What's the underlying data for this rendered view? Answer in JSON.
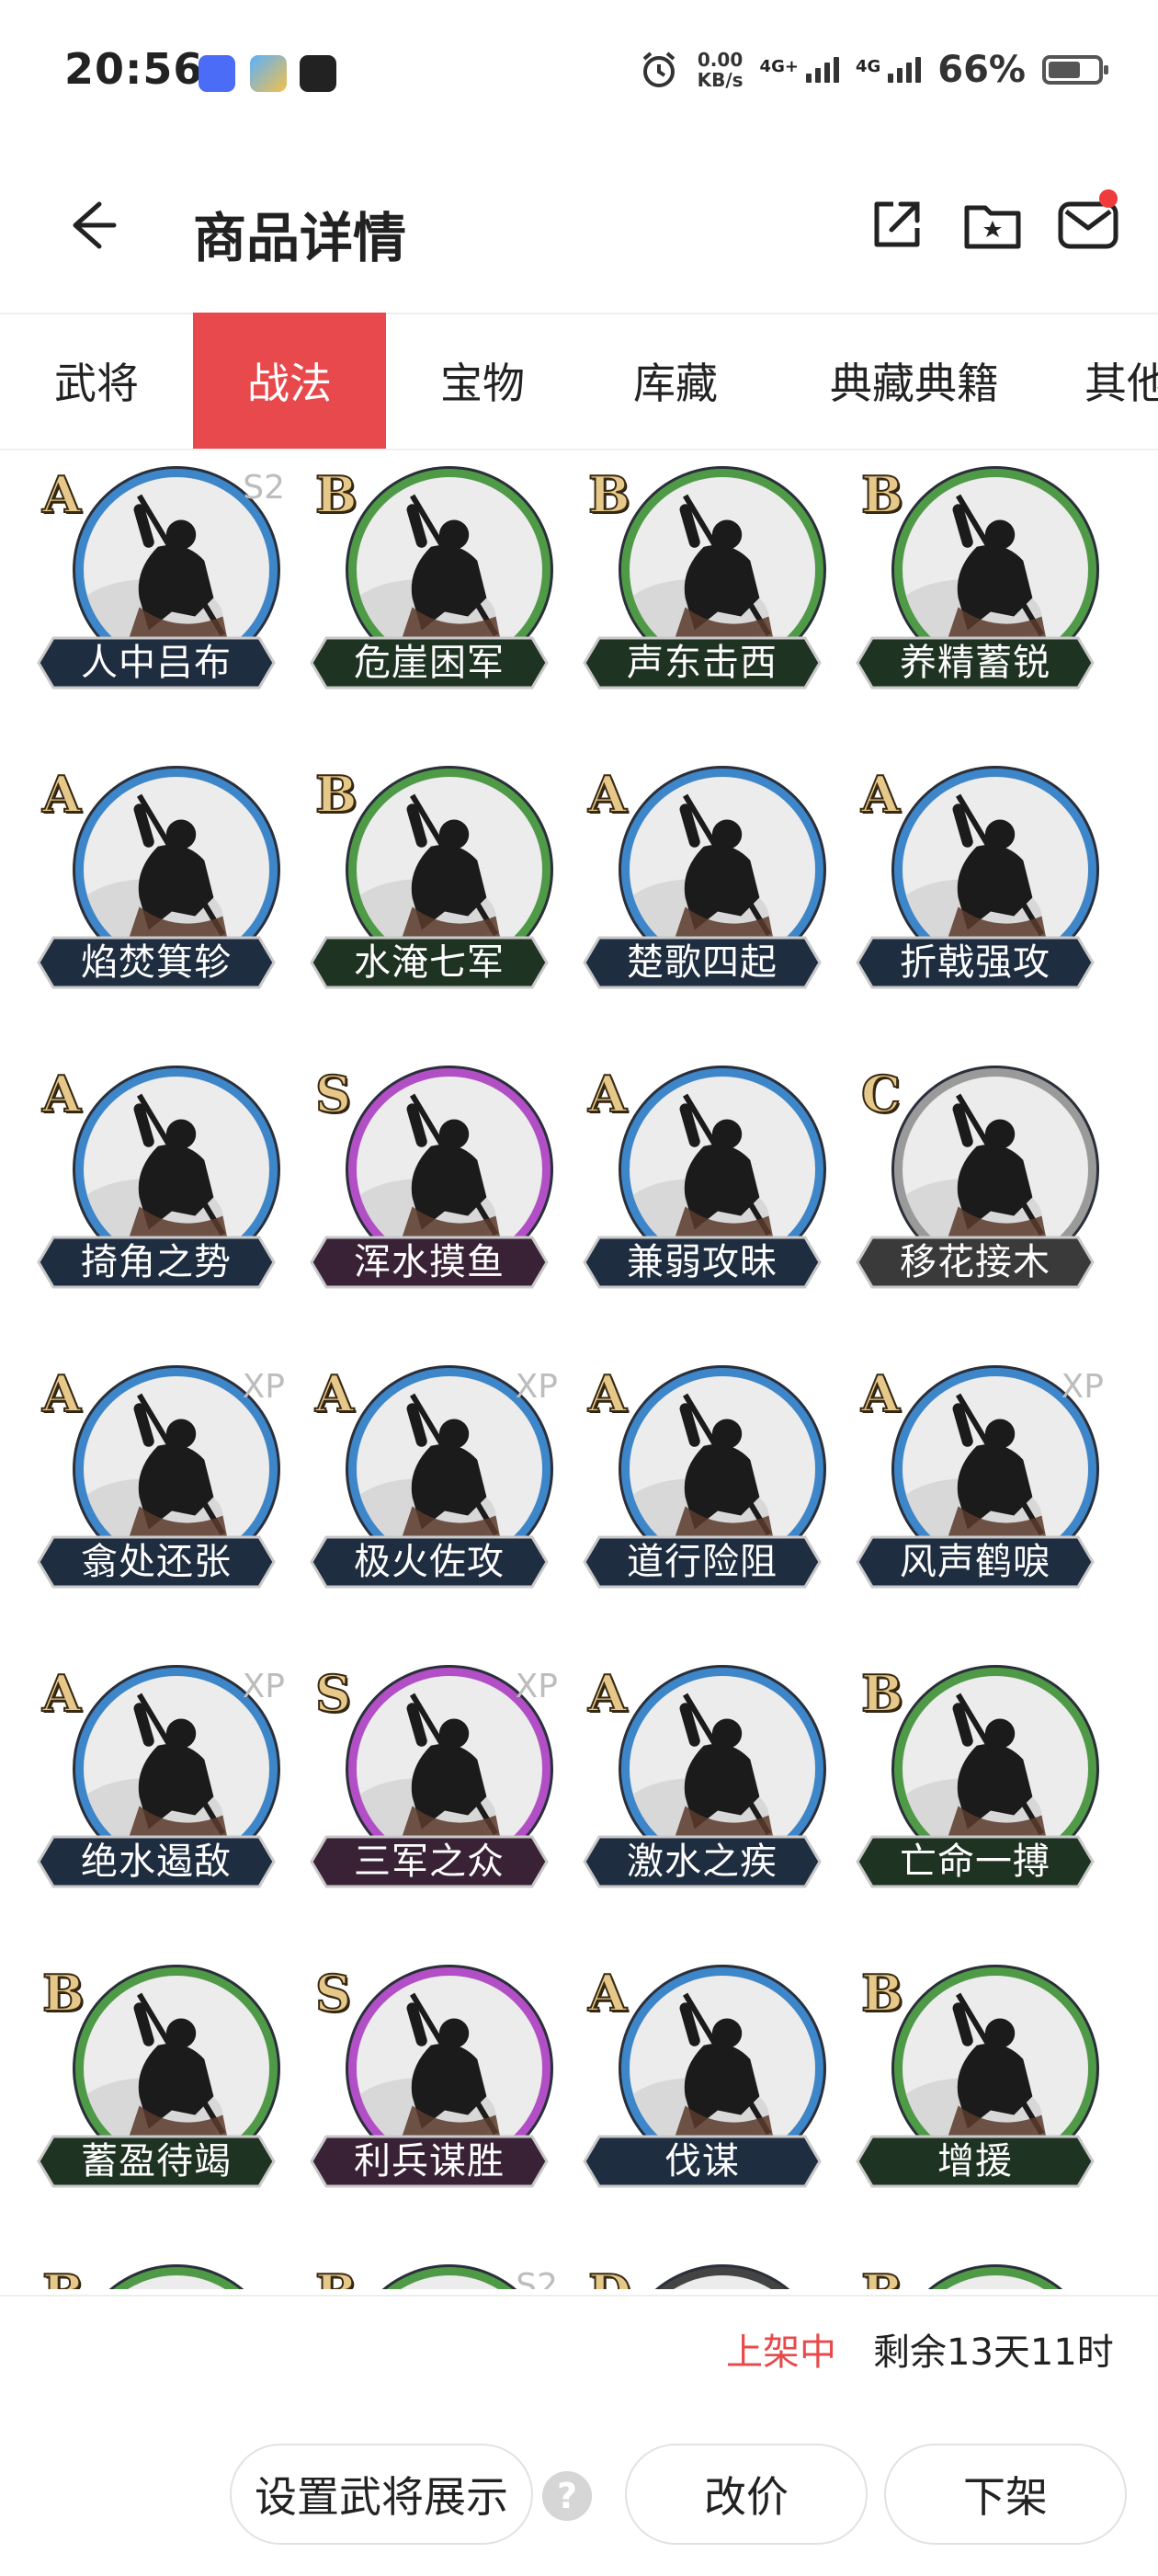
{
  "status_bar": {
    "time": "20:56",
    "speed_value": "0.00",
    "speed_unit": "KB/s",
    "net1": "4G+",
    "net2": "4G",
    "battery": "66%",
    "battery_level": 0.66,
    "app_icons": [
      "vivo-icon",
      "game-app-icon",
      "sina-icon"
    ]
  },
  "header": {
    "title": "商品详情",
    "icons": [
      "back-arrow-icon",
      "share-icon",
      "favorite-folder-icon",
      "mail-icon"
    ]
  },
  "tabs": [
    {
      "label": "武将",
      "active": false
    },
    {
      "label": "战法",
      "active": true
    },
    {
      "label": "宝物",
      "active": false
    },
    {
      "label": "库藏",
      "active": false
    },
    {
      "label": "典藏典籍",
      "active": false
    },
    {
      "label": "其他",
      "active": false
    }
  ],
  "colors": {
    "accent": "#e8494c",
    "grade_S": "#b24fc6",
    "grade_A": "#3d86c9",
    "grade_B": "#4f9a46",
    "grade_C": "#9a9a9a"
  },
  "skills": [
    {
      "name": "人中吕布",
      "grade": "A",
      "tag": "S2"
    },
    {
      "name": "危崖困军",
      "grade": "B",
      "tag": ""
    },
    {
      "name": "声东击西",
      "grade": "B",
      "tag": ""
    },
    {
      "name": "养精蓄锐",
      "grade": "B",
      "tag": ""
    },
    {
      "name": "焰焚箕轸",
      "grade": "A",
      "tag": ""
    },
    {
      "name": "水淹七军",
      "grade": "B",
      "tag": ""
    },
    {
      "name": "楚歌四起",
      "grade": "A",
      "tag": ""
    },
    {
      "name": "折戟强攻",
      "grade": "A",
      "tag": ""
    },
    {
      "name": "掎角之势",
      "grade": "A",
      "tag": ""
    },
    {
      "name": "浑水摸鱼",
      "grade": "S",
      "tag": ""
    },
    {
      "name": "兼弱攻昧",
      "grade": "A",
      "tag": ""
    },
    {
      "name": "移花接木",
      "grade": "C",
      "tag": ""
    },
    {
      "name": "翕处还张",
      "grade": "A",
      "tag": "XP"
    },
    {
      "name": "极火佐攻",
      "grade": "A",
      "tag": "XP"
    },
    {
      "name": "道行险阻",
      "grade": "A",
      "tag": ""
    },
    {
      "name": "风声鹤唳",
      "grade": "A",
      "tag": "XP"
    },
    {
      "name": "绝水遏敌",
      "grade": "A",
      "tag": "XP"
    },
    {
      "name": "三军之众",
      "grade": "S",
      "tag": "XP"
    },
    {
      "name": "激水之疾",
      "grade": "A",
      "tag": ""
    },
    {
      "name": "亡命一搏",
      "grade": "B",
      "tag": ""
    },
    {
      "name": "蓄盈待竭",
      "grade": "B",
      "tag": ""
    },
    {
      "name": "利兵谋胜",
      "grade": "S",
      "tag": ""
    },
    {
      "name": "伐谋",
      "grade": "A",
      "tag": ""
    },
    {
      "name": "增援",
      "grade": "B",
      "tag": ""
    },
    {
      "name": "",
      "grade": "B",
      "tag": ""
    },
    {
      "name": "",
      "grade": "B",
      "tag": "S2"
    },
    {
      "name": "",
      "grade": "D",
      "tag": ""
    },
    {
      "name": "",
      "grade": "B",
      "tag": ""
    }
  ],
  "footer": {
    "status": "上架中",
    "remaining": "剩余13天11时",
    "btn_display": "设置武将展示",
    "help": "?",
    "btn_price": "改价",
    "btn_off": "下架"
  }
}
